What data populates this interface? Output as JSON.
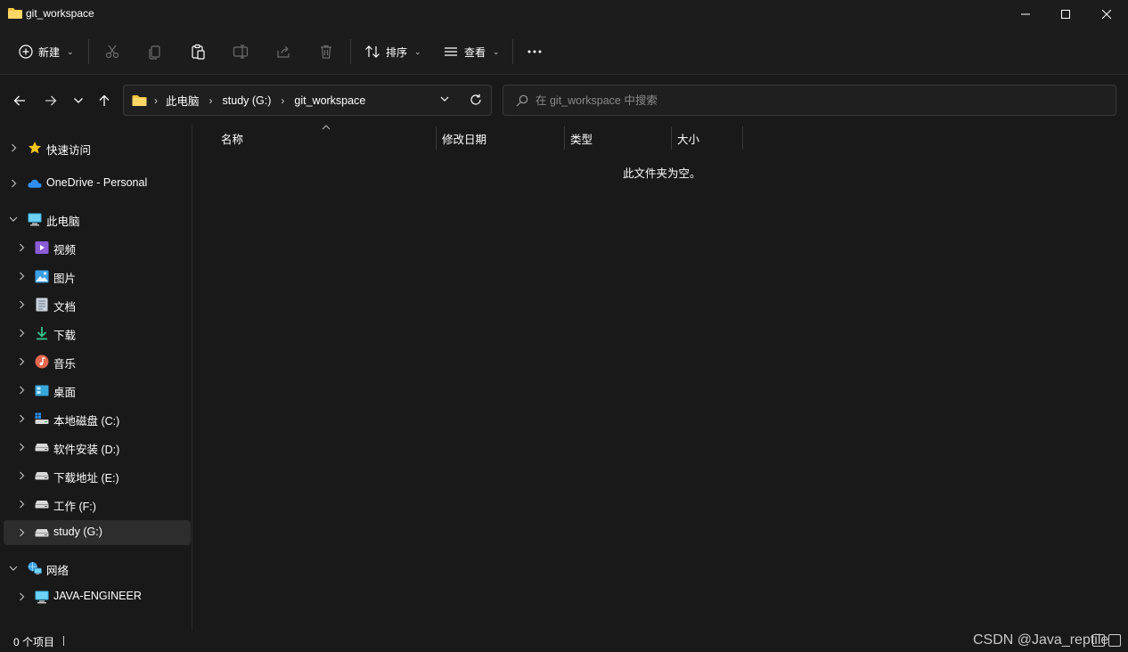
{
  "window": {
    "title": "git_workspace",
    "folder_icon": "folder-icon",
    "controls": [
      "minimize-icon",
      "maximize-icon",
      "close-icon"
    ]
  },
  "commandbar": {
    "new_label": "新建",
    "sort_label": "排序",
    "view_label": "查看",
    "tools": [
      "cut-icon",
      "copy-icon",
      "paste-icon",
      "rename-icon",
      "share-icon",
      "delete-icon"
    ],
    "more_icon": "more-icon"
  },
  "address": {
    "crumbs": [
      "此电脑",
      "study (G:)",
      "git_workspace"
    ]
  },
  "search": {
    "placeholder": "在 git_workspace 中搜索",
    "value": ""
  },
  "sidebar": {
    "items": [
      {
        "label": "快速访问",
        "icon": "star-icon"
      },
      {
        "label": "OneDrive - Personal",
        "icon": "cloud-icon"
      },
      {
        "label": "此电脑",
        "icon": "computer-icon"
      },
      {
        "label": "视频",
        "icon": "video-icon"
      },
      {
        "label": "图片",
        "icon": "picture-icon"
      },
      {
        "label": "文档",
        "icon": "document-icon"
      },
      {
        "label": "下载",
        "icon": "download-icon"
      },
      {
        "label": "音乐",
        "icon": "music-icon"
      },
      {
        "label": "桌面",
        "icon": "desktop-icon"
      },
      {
        "label": "本地磁盘 (C:)",
        "icon": "system-drive-icon"
      },
      {
        "label": "软件安装 (D:)",
        "icon": "drive-icon"
      },
      {
        "label": "下载地址 (E:)",
        "icon": "drive-icon"
      },
      {
        "label": "工作 (F:)",
        "icon": "drive-icon"
      },
      {
        "label": "study (G:)",
        "icon": "drive-icon",
        "selected": true
      },
      {
        "label": "网络",
        "icon": "network-icon"
      },
      {
        "label": "JAVA-ENGINEER",
        "icon": "monitor-icon"
      }
    ]
  },
  "content": {
    "columns": [
      "名称",
      "修改日期",
      "类型",
      "大小"
    ],
    "empty_message": "此文件夹为空。"
  },
  "status": {
    "item_count": "0 个项目",
    "watermark": "CSDN @Java_reptile"
  },
  "colors": {
    "background": "#191919",
    "chrome": "#1c1c1c",
    "selected_item": "#2d2d2d",
    "folder_yellow": "#f4c542"
  }
}
